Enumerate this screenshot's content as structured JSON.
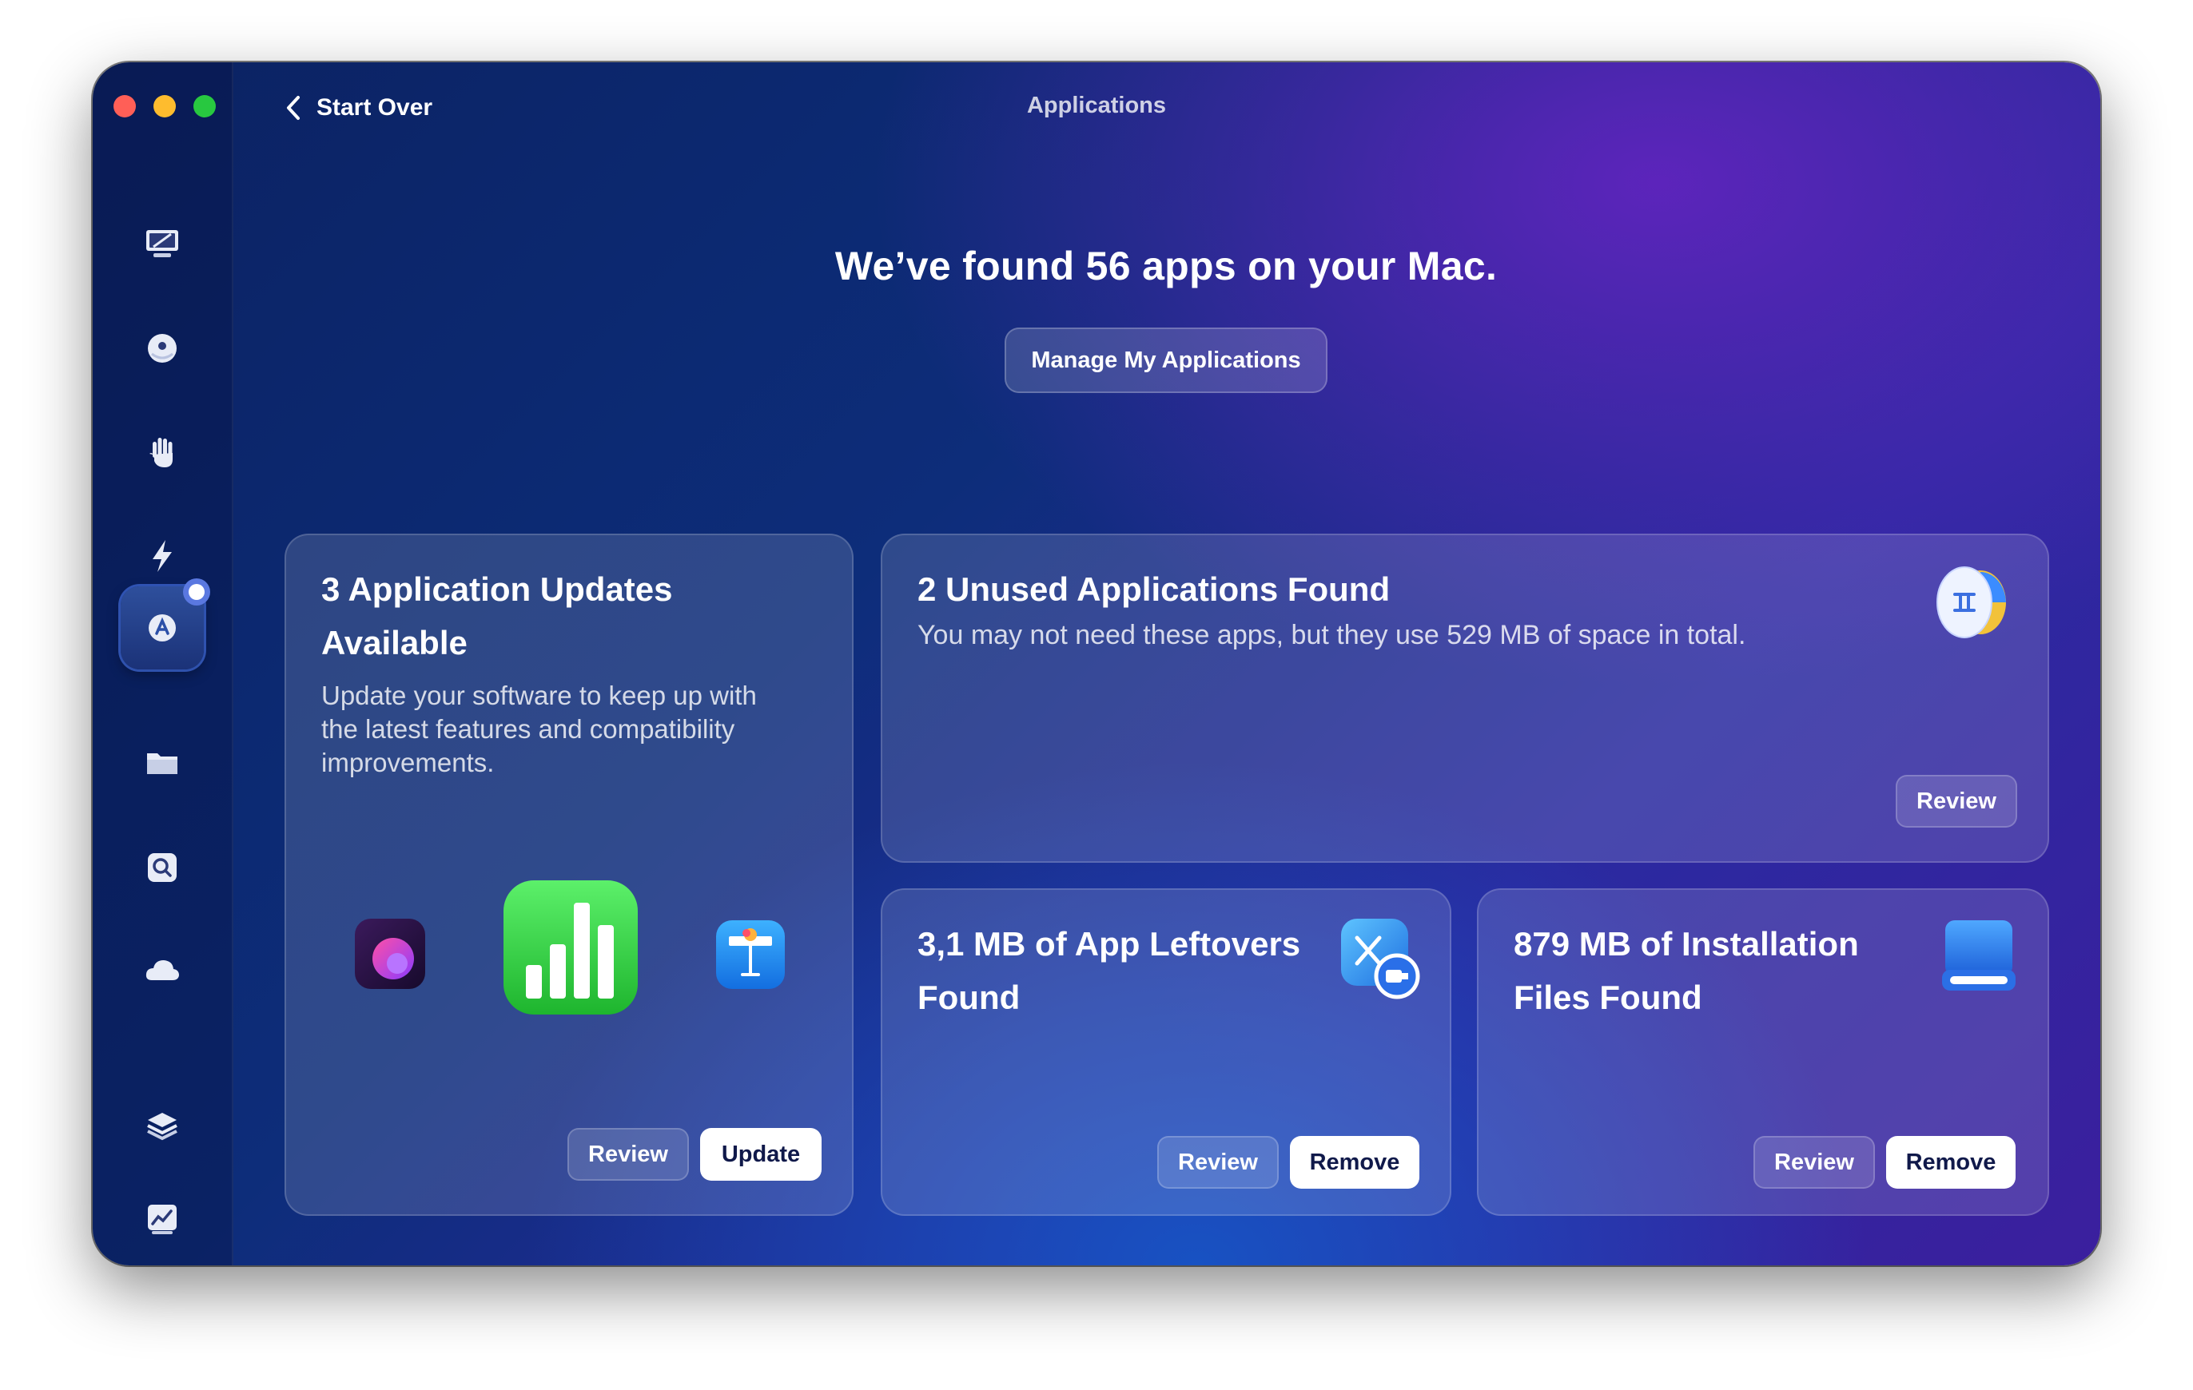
{
  "window": {
    "title": "Applications",
    "back_label": "Start Over"
  },
  "sidebar": {
    "items": [
      {
        "name": "smart-care",
        "icon": "display-icon"
      },
      {
        "name": "cleanup",
        "icon": "bubble-icon"
      },
      {
        "name": "protection",
        "icon": "hand-icon"
      },
      {
        "name": "performance",
        "icon": "lightning-icon"
      },
      {
        "name": "applications",
        "icon": "app-store-icon",
        "active": true
      },
      {
        "name": "my-clutter",
        "icon": "folder-icon"
      },
      {
        "name": "space-lens",
        "icon": "magnifier-icon"
      },
      {
        "name": "cloud-cleanup",
        "icon": "cloud-icon"
      },
      {
        "name": "assistant",
        "icon": "layers-icon"
      },
      {
        "name": "menu-app",
        "icon": "chart-icon"
      }
    ]
  },
  "main": {
    "headline": "We’ve found 56 apps on your Mac.",
    "manage_button": "Manage My Applications"
  },
  "cards": {
    "updates": {
      "title_line1": "3 Application Updates",
      "title_line2": "Available",
      "desc_line1": "Update your software to keep up with",
      "desc_line2": "the latest features and compatibility",
      "desc_line3": "improvements.",
      "review": "Review",
      "update": "Update",
      "icons": [
        "app-icon-purple-orb",
        "numbers-icon",
        "keynote-icon"
      ]
    },
    "unused": {
      "title": "2 Unused Applications Found",
      "desc": "You may not need these apps, but they use 529 MB of space in total.",
      "review": "Review",
      "icon": "gemini-icon"
    },
    "leftovers": {
      "title_line1": "3,1 MB of App Leftovers",
      "title_line2": "Found",
      "review": "Review",
      "remove": "Remove",
      "icon": "leftovers-icon"
    },
    "installation": {
      "title_line1": "879 MB of Installation",
      "title_line2": "Files Found",
      "review": "Review",
      "remove": "Remove",
      "icon": "installer-drive-icon"
    }
  },
  "colors": {
    "accent": "#5a78e0",
    "numbers_green": "#2fcf3f",
    "keynote_blue": "#1e8cf0"
  }
}
